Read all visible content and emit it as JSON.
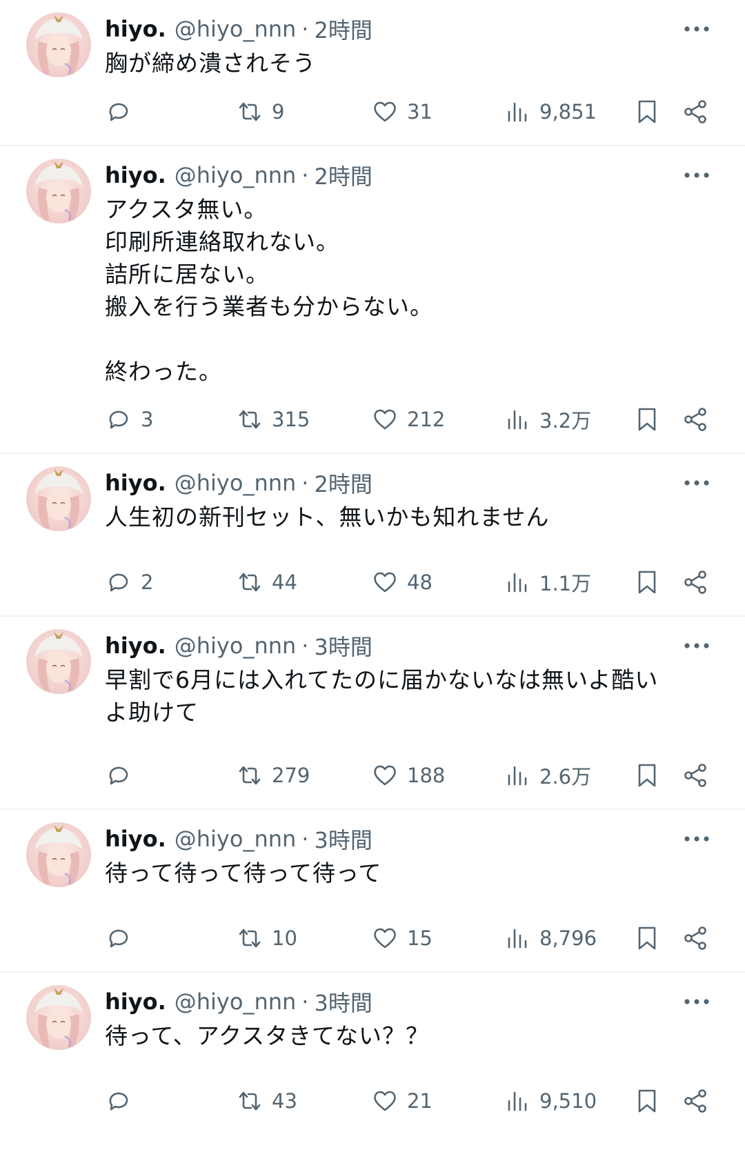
{
  "tweets": [
    {
      "name": "hiyo.",
      "handle": "@hiyo_nnn",
      "sep": "·",
      "time": "2時間",
      "text": "胸が締め潰されそう",
      "replies": "",
      "retweets": "9",
      "likes": "31",
      "views": "9,851"
    },
    {
      "name": "hiyo.",
      "handle": "@hiyo_nnn",
      "sep": "·",
      "time": "2時間",
      "text": "アクスタ無い。\n印刷所連絡取れない。\n詰所に居ない。\n搬入を行う業者も分からない。\n\n終わった。",
      "replies": "3",
      "retweets": "315",
      "likes": "212",
      "views": "3.2万"
    },
    {
      "name": "hiyo.",
      "handle": "@hiyo_nnn",
      "sep": "·",
      "time": "2時間",
      "text": "人生初の新刊セット、無いかも知れません",
      "replies": "2",
      "retweets": "44",
      "likes": "48",
      "views": "1.1万"
    },
    {
      "name": "hiyo.",
      "handle": "@hiyo_nnn",
      "sep": "·",
      "time": "3時間",
      "text": "早割で6月には入れてたのに届かないなは無いよ酷い\nよ助けて",
      "replies": "",
      "retweets": "279",
      "likes": "188",
      "views": "2.6万"
    },
    {
      "name": "hiyo.",
      "handle": "@hiyo_nnn",
      "sep": "·",
      "time": "3時間",
      "text": "待って待って待って待って",
      "replies": "",
      "retweets": "10",
      "likes": "15",
      "views": "8,796"
    },
    {
      "name": "hiyo.",
      "handle": "@hiyo_nnn",
      "sep": "·",
      "time": "3時間",
      "text": "待って、アクスタきてない？？",
      "replies": "",
      "retweets": "43",
      "likes": "21",
      "views": "9,510"
    }
  ],
  "icons": {
    "reply": "reply-icon",
    "retweet": "retweet-icon",
    "like": "heart-icon",
    "views": "views-icon",
    "bookmark": "bookmark-icon",
    "share": "share-icon",
    "more": "more-icon"
  },
  "colors": {
    "text": "#0f1419",
    "secondary": "#536471",
    "divider": "#eff3f4"
  }
}
